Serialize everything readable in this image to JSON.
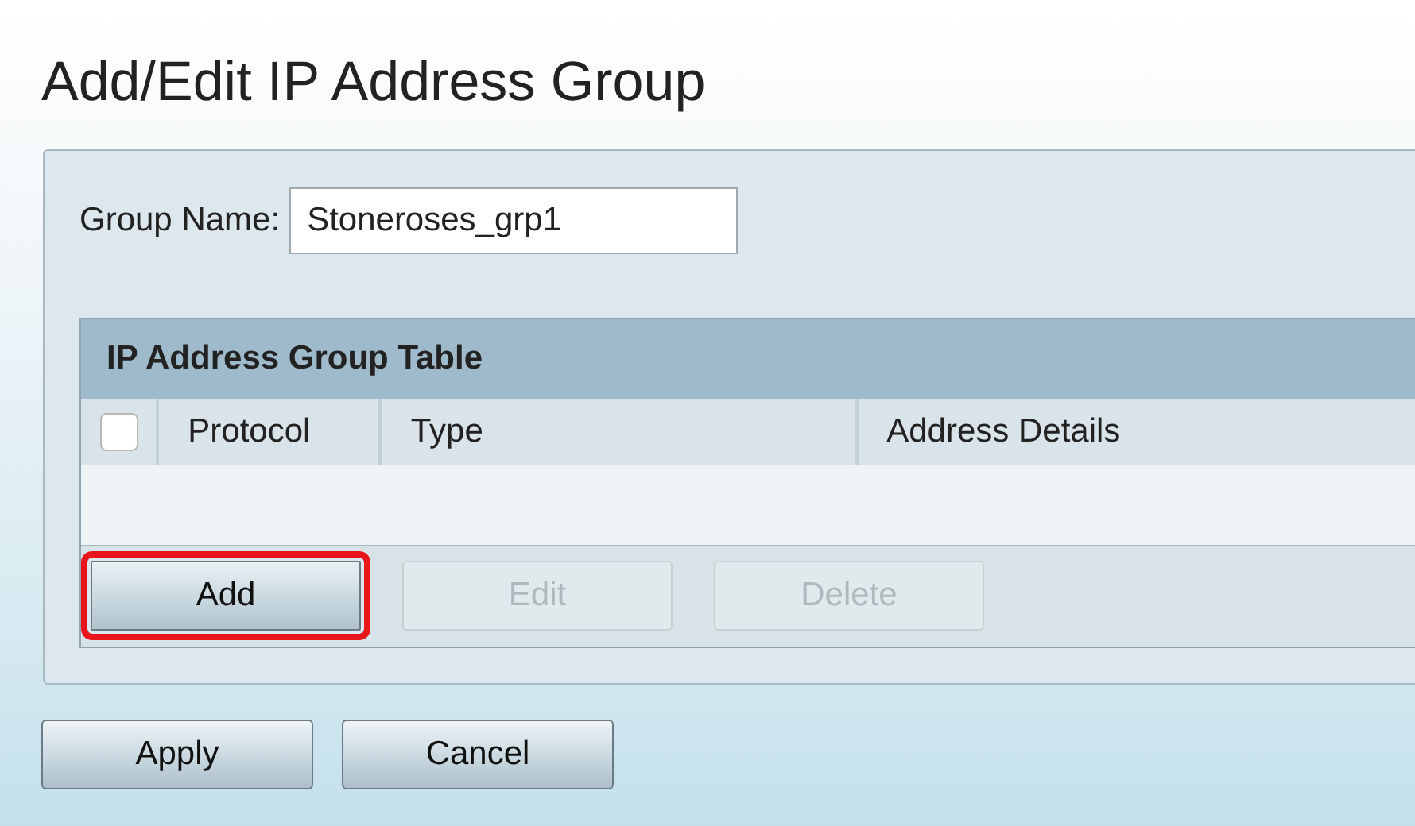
{
  "title": "Add/Edit IP Address Group",
  "group_name": {
    "label": "Group Name:",
    "value": "Stoneroses_grp1"
  },
  "table": {
    "title": "IP Address Group Table",
    "select_all": {
      "checked": false
    },
    "columns": [
      "Protocol",
      "Type",
      "Address Details"
    ],
    "buttons": [
      {
        "label": "Add",
        "disabled": false,
        "highlighted": true
      },
      {
        "label": "Edit",
        "disabled": true,
        "highlighted": false
      },
      {
        "label": "Delete",
        "disabled": true,
        "highlighted": false
      }
    ]
  },
  "buttons": [
    {
      "label": "Apply"
    },
    {
      "label": "Cancel"
    }
  ]
}
